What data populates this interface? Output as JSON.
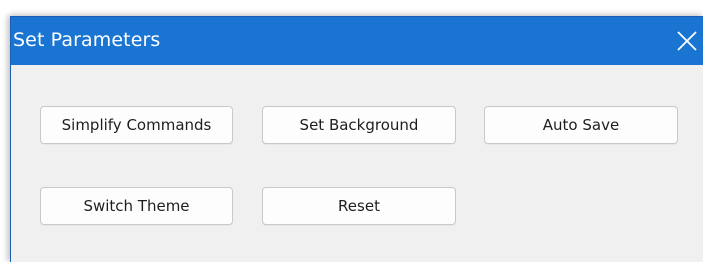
{
  "window": {
    "title": "Set Parameters",
    "close_icon": "close-icon",
    "accent_color": "#1a75d2"
  },
  "buttons": {
    "simplify_commands": "Simplify Commands",
    "set_background": "Set Background",
    "auto_save": "Auto Save",
    "switch_theme": "Switch Theme",
    "reset": "Reset"
  }
}
